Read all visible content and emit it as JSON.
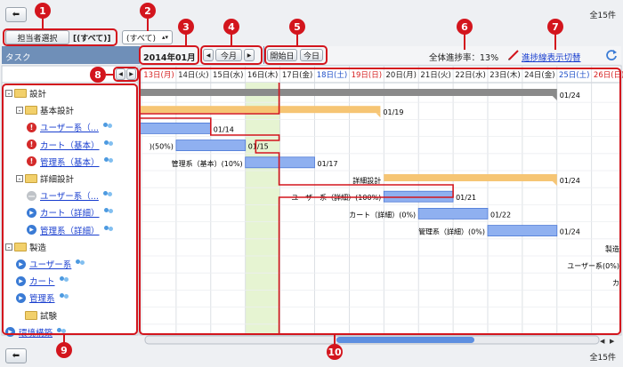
{
  "toolbar": {
    "back_label": "◀",
    "total_count": "全15件",
    "assignee_button": "担当者選択",
    "assignee_current": "[(すべて)]",
    "assignee_select_value": "(すべて)"
  },
  "header": {
    "task_column": "タスク",
    "month": "2014年01月",
    "today_month_button": "今月",
    "start_date_button": "開始日",
    "today_button": "今日",
    "progress_label": "全体進捗率：13%",
    "progress_toggle_link": "進捗線表示切替"
  },
  "days": [
    {
      "label": "13日(月)",
      "type": "holiday"
    },
    {
      "label": "14日(火)",
      "type": "weekday"
    },
    {
      "label": "15日(水)",
      "type": "weekday"
    },
    {
      "label": "16日(木)",
      "type": "weekday"
    },
    {
      "label": "17日(金)",
      "type": "weekday"
    },
    {
      "label": "18日(土)",
      "type": "saturday"
    },
    {
      "label": "19日(日)",
      "type": "holiday"
    },
    {
      "label": "20日(月)",
      "type": "weekday"
    },
    {
      "label": "21日(火)",
      "type": "weekday"
    },
    {
      "label": "22日(水)",
      "type": "weekday"
    },
    {
      "label": "23日(木)",
      "type": "weekday"
    },
    {
      "label": "24日(金)",
      "type": "weekday"
    },
    {
      "label": "25日(土)",
      "type": "saturday"
    },
    {
      "label": "26日(日)",
      "type": "holiday"
    }
  ],
  "tree": [
    {
      "label": "設計",
      "kind": "folder",
      "level": 0,
      "expander": "⊟"
    },
    {
      "label": "基本設計",
      "kind": "folder",
      "level": 1,
      "expander": "⊟"
    },
    {
      "label": "ユーザー系（...",
      "kind": "task",
      "level": 2,
      "status": "late"
    },
    {
      "label": "カート（基本）",
      "kind": "task",
      "level": 2,
      "status": "late"
    },
    {
      "label": "管理系（基本）",
      "kind": "task",
      "level": 2,
      "status": "late"
    },
    {
      "label": "詳細設計",
      "kind": "folder",
      "level": 1,
      "expander": "⊟"
    },
    {
      "label": "ユーザー系（...",
      "kind": "task",
      "level": 2,
      "status": "done"
    },
    {
      "label": "カート（詳細）",
      "kind": "task",
      "level": 2,
      "status": "normal"
    },
    {
      "label": "管理系（詳細）",
      "kind": "task",
      "level": 2,
      "status": "normal"
    },
    {
      "label": "製造",
      "kind": "folder",
      "level": 0,
      "expander": "⊟"
    },
    {
      "label": "ユーザー系",
      "kind": "task",
      "level": 1,
      "status": "normal"
    },
    {
      "label": "カート",
      "kind": "task",
      "level": 1,
      "status": "normal"
    },
    {
      "label": "管理系",
      "kind": "task",
      "level": 1,
      "status": "normal"
    },
    {
      "label": "試験",
      "kind": "folder",
      "level": 1,
      "expander": ""
    },
    {
      "label": "環境構築",
      "kind": "task",
      "level": 0,
      "status": "normal"
    }
  ],
  "bars": [
    {
      "row": 0,
      "start": -0.1,
      "end": 12.0,
      "color": "#8a8a8a",
      "label_left": "",
      "label_right": "01/24"
    },
    {
      "row": 1,
      "start": -0.1,
      "end": 6.9,
      "color": "#f6c574",
      "label_left": "",
      "label_right": "01/19"
    },
    {
      "row": 2,
      "start": -0.1,
      "end": 2.0,
      "color": "#8fb0f0",
      "label_left": "",
      "label_right": "01/14"
    },
    {
      "row": 3,
      "start": 1.0,
      "end": 3.0,
      "color": "#8fb0f0",
      "label_left": ")(50%)",
      "label_right": "01/15"
    },
    {
      "row": 4,
      "start": 3.0,
      "end": 5.0,
      "color": "#8fb0f0",
      "label_left": "管理系（基本）(10%)",
      "label_right": "01/17"
    },
    {
      "row": 5,
      "start": 7.0,
      "end": 12.0,
      "color": "#f6c574",
      "label_left": "詳細設計",
      "label_right": "01/24"
    },
    {
      "row": 6,
      "start": 7.0,
      "end": 9.0,
      "color": "#8fb0f0",
      "label_left": "ユーザー系（詳細）(100%)",
      "label_right": "01/21"
    },
    {
      "row": 7,
      "start": 8.0,
      "end": 10.0,
      "color": "#8fb0f0",
      "label_left": "カート（詳細）(0%)",
      "label_right": "01/22"
    },
    {
      "row": 8,
      "start": 10.0,
      "end": 12.0,
      "color": "#8fb0f0",
      "label_left": "管理系（詳細）(0%)",
      "label_right": "01/24"
    },
    {
      "row": 9,
      "start": 14.0,
      "end": 14.0,
      "color": "#8fb0f0",
      "label_left": "製造",
      "label_right": ""
    },
    {
      "row": 10,
      "start": 14.0,
      "end": 14.0,
      "color": "#8fb0f0",
      "label_left": "ユーザー系(0%)",
      "label_right": ""
    },
    {
      "row": 11,
      "start": 14.0,
      "end": 14.0,
      "color": "#8fb0f0",
      "label_left": "カ",
      "label_right": ""
    }
  ],
  "callouts": [
    "1",
    "2",
    "3",
    "4",
    "5",
    "6",
    "7",
    "8",
    "9",
    "10"
  ],
  "colors": {
    "header_bg": "#6f8fb8",
    "holiday": "#d62020",
    "saturday": "#2050c8",
    "today_column": "#e6f4d2",
    "progress_line": "#d3151d"
  },
  "icons": {
    "back": "arrow-left-icon",
    "refresh": "refresh-icon",
    "pencil": "pencil-icon"
  }
}
